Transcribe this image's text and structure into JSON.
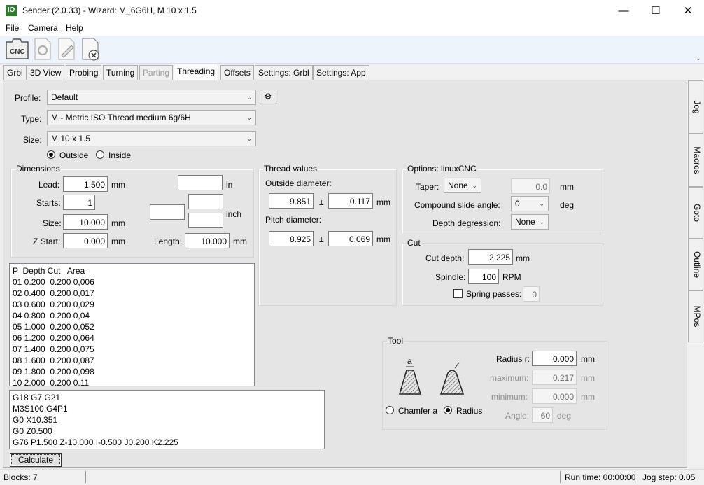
{
  "window": {
    "app_icon": "IO",
    "title": "Sender (2.0.33) - Wizard: M_6G6H, M 10 x 1.5",
    "minimize": "—",
    "maximize": "☐",
    "close": "✕"
  },
  "menu": {
    "file": "File",
    "camera": "Camera",
    "help": "Help"
  },
  "toolbar": {
    "cnc_label": "CNC"
  },
  "tabs": [
    {
      "label": "Grbl"
    },
    {
      "label": "3D View"
    },
    {
      "label": "Probing"
    },
    {
      "label": "Turning"
    },
    {
      "label": "Parting"
    },
    {
      "label": "Threading"
    },
    {
      "label": "Offsets"
    },
    {
      "label": "Settings: Grbl"
    },
    {
      "label": "Settings: App"
    }
  ],
  "side_tabs": [
    {
      "label": "Jog"
    },
    {
      "label": "Macros"
    },
    {
      "label": "Goto"
    },
    {
      "label": "Outline"
    },
    {
      "label": "MPos"
    }
  ],
  "profile": {
    "label": "Profile:",
    "value": "Default"
  },
  "type": {
    "label": "Type:",
    "value": "M - Metric ISO Thread medium 6g/6H"
  },
  "size": {
    "label": "Size:",
    "value": "M 10 x 1.5"
  },
  "side": {
    "outside": "Outside",
    "inside": "Inside"
  },
  "dimensions": {
    "title": "Dimensions",
    "lead_label": "Lead:",
    "lead": "1.500",
    "lead_unit": "mm",
    "lead_in_unit": "in",
    "starts_label": "Starts:",
    "starts": "1",
    "size_label": "Size:",
    "size": "10.000",
    "size_unit": "mm",
    "zstart_label": "Z Start:",
    "zstart": "0.000",
    "zstart_unit": "mm",
    "inch_unit": "inch",
    "length_label": "Length:",
    "length": "10.000",
    "length_unit": "mm"
  },
  "thread_values": {
    "title": "Thread values",
    "outside_label": "Outside diameter:",
    "outside": "9.851",
    "outside_tol": "0.117",
    "pitch_label": "Pitch diameter:",
    "pitch": "8.925",
    "pitch_tol": "0.069",
    "pm": "±",
    "unit": "mm"
  },
  "options": {
    "title": "Options: linuxCNC",
    "taper_label": "Taper:",
    "taper": "None",
    "taper_value": "0.0",
    "taper_unit": "mm",
    "compound_label": "Compound slide angle:",
    "compound": "0",
    "compound_unit": "deg",
    "depth_deg_label": "Depth degression:",
    "depth_deg": "None"
  },
  "cut": {
    "title": "Cut",
    "depth_label": "Cut depth:",
    "depth": "2.225",
    "depth_unit": "mm",
    "spindle_label": "Spindle:",
    "spindle": "100",
    "spindle_unit": "RPM",
    "spring_label": "Spring passes:",
    "spring": "0"
  },
  "passes": {
    "header": "P  Depth Cut   Area",
    "rows": [
      "01 0.200  0.200 0,006",
      "02 0.400  0.200 0,017",
      "03 0.600  0.200 0,029",
      "04 0.800  0.200 0,04",
      "05 1.000  0.200 0,052",
      "06 1.200  0.200 0,064",
      "07 1.400  0.200 0,075",
      "08 1.600  0.200 0,087",
      "09 1.800  0.200 0,098",
      "10 2.000  0.200 0,11"
    ]
  },
  "gcode": [
    "G18 G7 G21",
    "M3S100 G4P1",
    "G0 X10.351",
    "G0 Z0.500",
    "G76 P1.500 Z-10.000 I-0.500 J0.200 K2.225"
  ],
  "calculate": "Calculate",
  "tool": {
    "title": "Tool",
    "a_label": "a",
    "chamfer": "Chamfer a",
    "radius": "Radius",
    "radius_label": "Radius r:",
    "radius_value": "0.000",
    "max_label": "maximum:",
    "max_value": "0.217",
    "min_label": "minimum:",
    "min_value": "0.000",
    "angle_label": "Angle:",
    "angle_value": "60",
    "angle_unit": "deg",
    "unit": "mm"
  },
  "status": {
    "blocks": "Blocks: 7",
    "run_time": "Run time: 00:00:00",
    "jog_step": "Jog step: 0.05"
  }
}
